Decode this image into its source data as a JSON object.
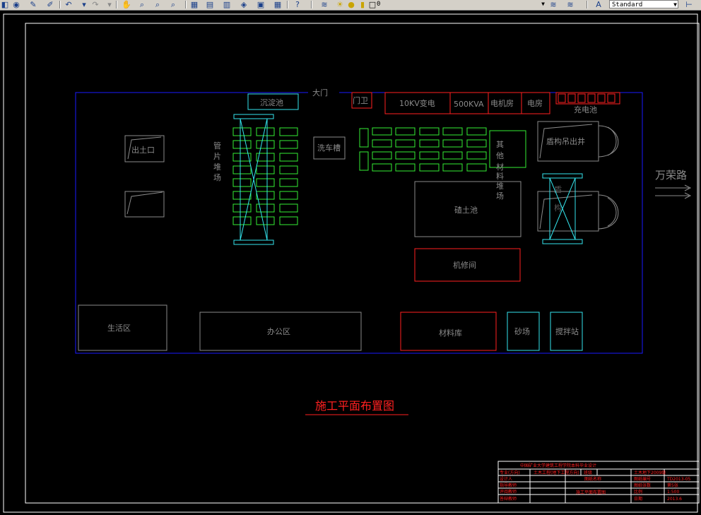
{
  "toolbar": {
    "layer_value": "0",
    "textstyle_value": "Standard"
  },
  "drawing": {
    "title": "施工平面布置图",
    "gate": "大门",
    "guard": "门卫",
    "transformer": "10KV变电",
    "kva": "500KVA",
    "generator": "电机房",
    "electric_room": "电房",
    "charging_pool": "充电池",
    "sedimentation_tank": "沉淀池",
    "car_wash": "洗车槽",
    "exit": "出土口",
    "segment_yard": "管片堆场",
    "other_materials": "其他材料堆场",
    "muck_pit": "碴土池",
    "shield_shaft": "盾构吊出井",
    "repair_shop": "机修间",
    "living_area": "生活区",
    "office_area": "办公区",
    "material_store": "材料库",
    "sand_yard": "砂场",
    "mixing_station": "搅拌站",
    "road": "万荣路",
    "partial_vertical": "盾构"
  },
  "title_block": {
    "r1": "中国矿业大学建筑工程学院本科毕业设计",
    "r2a": "专业(方向)",
    "r2b": "土木工程(地下工程方向)",
    "r2c": "班级",
    "r2d": "土木地下2009级",
    "r3a": "设计人",
    "r3b": "图纸名称",
    "r3c": "图纸编号",
    "r3d": "TD2013-05",
    "r4a": "指导教师",
    "r4b": "施工平面布置图",
    "r4c": "图纸张数",
    "r4d": "第5张",
    "r5a": "评阅教师",
    "r5b": "比例",
    "r5c": "1:500",
    "r6a": "答辩教师",
    "r6b": "日期",
    "r6c": "2013.6"
  },
  "colors": {
    "site_boundary": "#1a1aff",
    "red": "#ff2020",
    "green": "#33ee33",
    "cyan": "#33e5ee",
    "gray": "#8a8a8a",
    "white": "#ffffff"
  }
}
